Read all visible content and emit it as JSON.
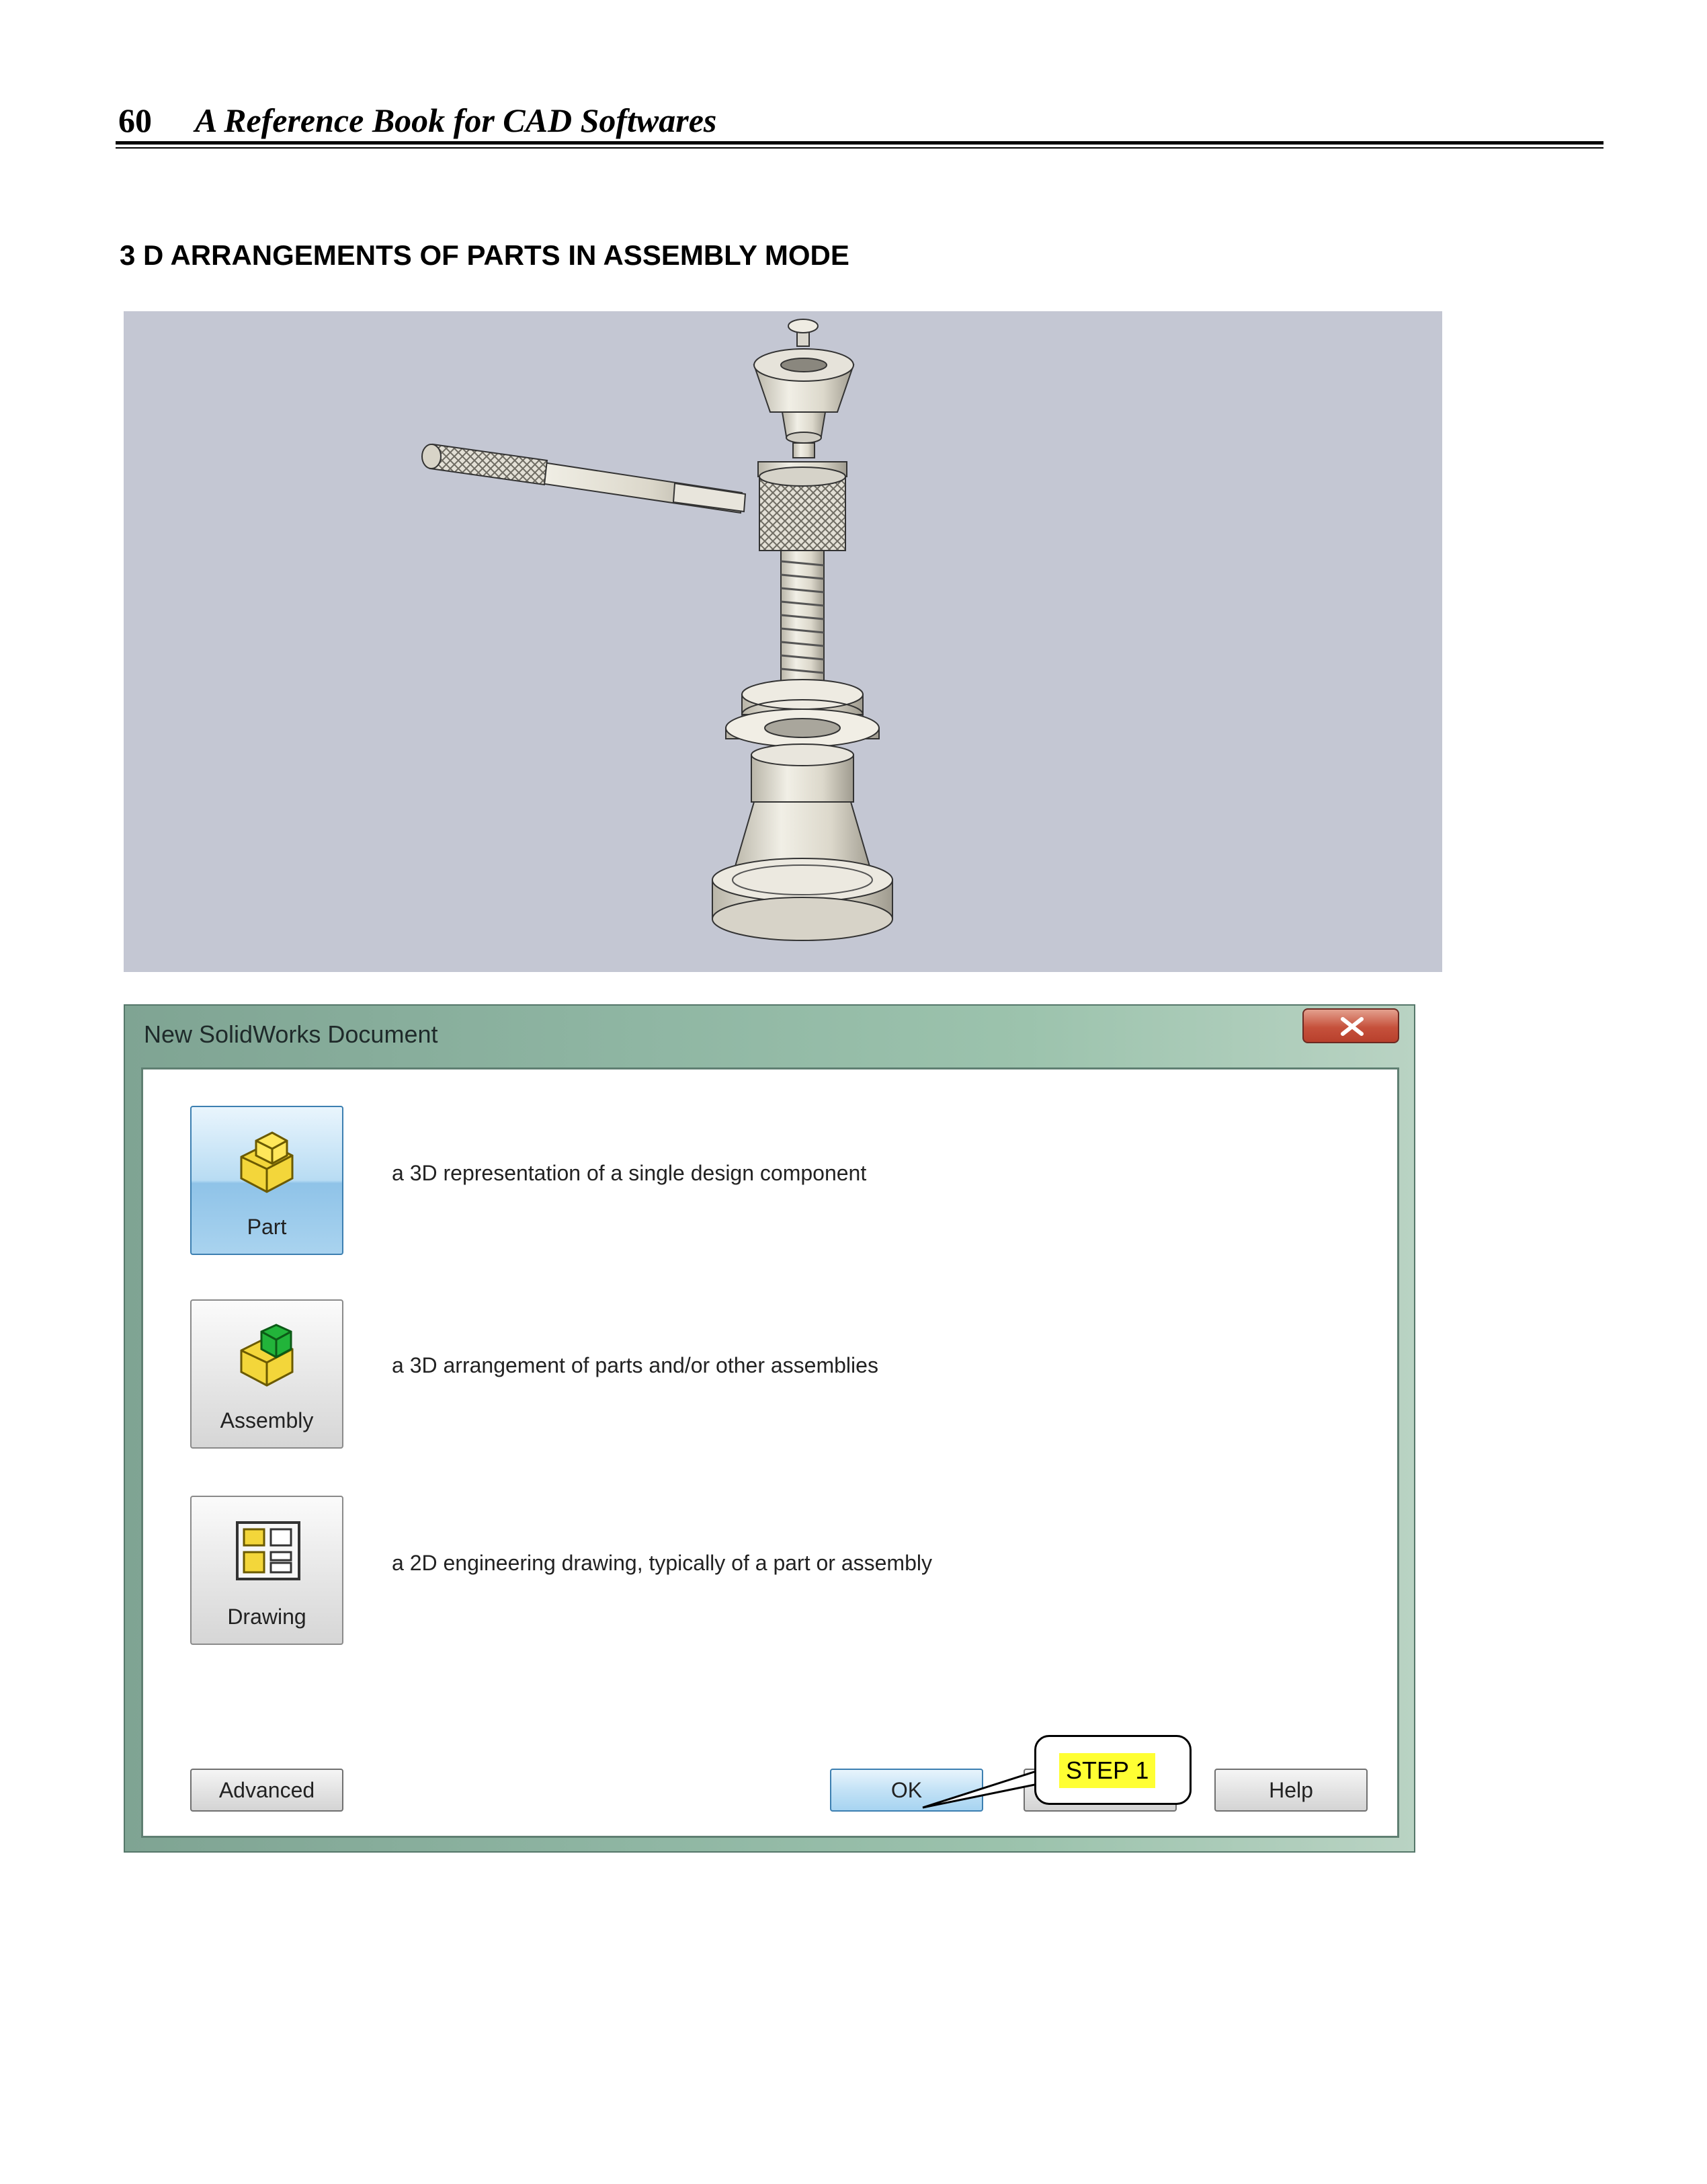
{
  "header": {
    "page_number": "60",
    "book_title": "A Reference Book for CAD Softwares"
  },
  "section": {
    "heading": "3 D ARRANGEMENTS OF PARTS IN ASSEMBLY MODE"
  },
  "dialog": {
    "title": "New SolidWorks Document",
    "options": [
      {
        "label": "Part",
        "description": "a 3D representation of a single design component",
        "selected": true,
        "icon": "part-icon"
      },
      {
        "label": "Assembly",
        "description": "a 3D arrangement of parts and/or other assemblies",
        "selected": false,
        "icon": "assembly-icon"
      },
      {
        "label": "Drawing",
        "description": "a 2D engineering drawing, typically of a part or assembly",
        "selected": false,
        "icon": "drawing-icon"
      }
    ],
    "buttons": {
      "advanced": "Advanced",
      "ok": "OK",
      "cancel": "Cancel",
      "help": "Help"
    },
    "callout": "STEP 1"
  },
  "colors": {
    "viewport_bg": "#c4c7d3",
    "selected_tile": "#8fc3e8",
    "callout_highlight": "#ffff33",
    "close_button": "#c6513c"
  }
}
